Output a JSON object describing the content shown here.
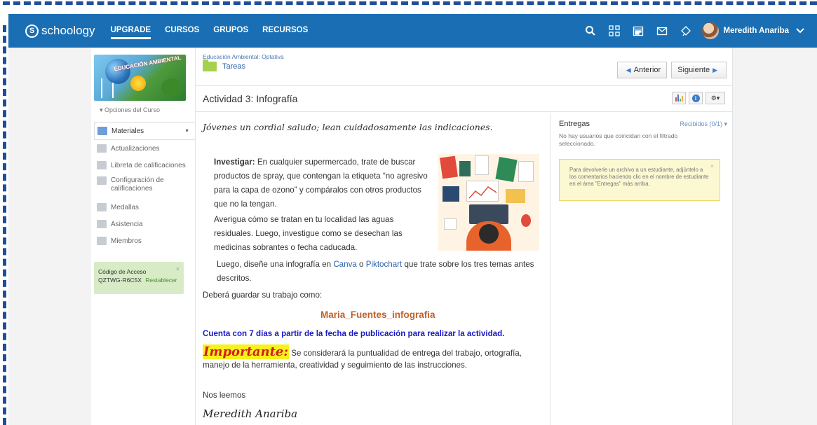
{
  "topnav": {
    "logo_letter": "S",
    "logo_text": "schoology",
    "links": [
      "UPGRADE",
      "CURSOS",
      "GRUPOS",
      "RECURSOS"
    ],
    "user_name": "Meredith Anariba",
    "icons": [
      "search-icon",
      "apps-grid-icon",
      "calendar-icon",
      "mail-icon",
      "notifications-icon"
    ],
    "bar_color": "#1a6fb4"
  },
  "sidebar": {
    "course_image_text": "EDUCACIÓN AMBIENTAL",
    "course_options": "▾  Opciones del Curso",
    "items": [
      {
        "label": "Materiales"
      },
      {
        "label": "Actualizaciones"
      },
      {
        "label": "Libreta de calificaciones"
      },
      {
        "label": "Configuración de calificaciones"
      },
      {
        "label": "Medallas"
      },
      {
        "label": "Asistencia"
      },
      {
        "label": "Miembros"
      }
    ],
    "access": {
      "title": "Código de Acceso",
      "code": "QZTWG-R6C5X",
      "reset": "Restablecer",
      "close": "×"
    }
  },
  "header": {
    "course_name": "Educación Ambiental: Optativa",
    "folder": "Tareas",
    "prev": "Anterior",
    "next": "Siguiente",
    "title": "Actividad 3: Infografía"
  },
  "assignment": {
    "greeting": "Jóvenes un cordial saludo; lean cuidadosamente las indicaciones.",
    "investigate_label": "Investigar:",
    "investigate_text": " En cualquier supermercado, trate de buscar productos de spray, que contengan la etiqueta “no agresivo para la capa de ozono” y compáralos con otros productos que no la tengan.",
    "para2": "Averigua cómo se tratan en tu localidad las aguas residuales. Luego, investigue como se desechan las medicinas sobrantes o fecha caducada.",
    "para3_a": "Luego, diseñe una infografía en ",
    "link_canva": "Canva",
    "para3_b": " o ",
    "link_pikto": "Piktochart",
    "para3_c": " que trate sobre   los tres temas antes descritos.",
    "save_as": "Deberá guardar su trabajo como:",
    "filename": "Maria_Fuentes_infografia",
    "deadline": "Cuenta con 7 días a partir de la fecha de publicación para realizar la actividad.",
    "important_word": "Importante:",
    "important_text": " Se considerará la puntualidad de entrega del trabajo, ortografía, manejo de la herramienta, creatividad y seguimiento de las instrucciones.",
    "closing": "Nos leemos",
    "signature": "Meredith Anariba"
  },
  "submissions": {
    "title": "Entregas",
    "received": "Recibidos (0/1) ▾",
    "note": "No hay usuarios que coincidan con el filtrado seleccionado.",
    "tip": "Para devolverle un archivo a un estudiante, adjúntelo a los comentarios haciendo clic en el nombre de estudiante en el área \"Entregas\" más arriba.",
    "tip_close": "×"
  }
}
